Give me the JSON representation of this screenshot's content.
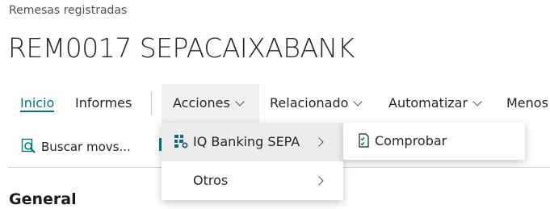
{
  "breadcrumb": "Remesas registradas",
  "title": "REM0017 SEPACAIXABANK",
  "nav": {
    "inicio": "Inicio",
    "informes": "Informes",
    "acciones": "Acciones",
    "relacionado": "Relacionado",
    "automatizar": "Automatizar",
    "menos": "Menos"
  },
  "actions": {
    "buscar": "Buscar movs..."
  },
  "menu": {
    "iq_banking": "IQ Banking SEPA",
    "otros": "Otros",
    "comprobar": "Comprobar"
  },
  "section": {
    "general": "General"
  },
  "colors": {
    "accent": "#00767c",
    "hover": "#ececec"
  }
}
